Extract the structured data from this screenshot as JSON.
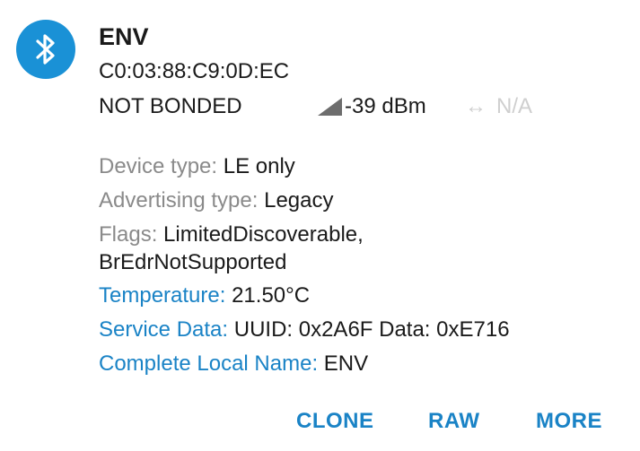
{
  "device": {
    "icon": "bluetooth-icon",
    "name": "ENV",
    "mac": "C0:03:88:C9:0D:EC",
    "bond_state": "NOT BONDED",
    "rssi": "-39 dBm",
    "interval_icon": "left-right-arrow-icon",
    "interval": "N/A"
  },
  "details": {
    "device_type": {
      "label": "Device type: ",
      "value": "LE only"
    },
    "advertising_type": {
      "label": "Advertising type: ",
      "value": "Legacy"
    },
    "flags": {
      "label": "Flags: ",
      "value": "LimitedDiscoverable, BrEdrNotSupported"
    },
    "temperature": {
      "label": "Temperature: ",
      "value": "21.50°C"
    },
    "service_data": {
      "label": "Service Data: ",
      "value": "UUID: 0x2A6F Data: 0xE716"
    },
    "local_name": {
      "label": "Complete Local Name: ",
      "value": "ENV"
    }
  },
  "actions": {
    "clone": "CLONE",
    "raw": "RAW",
    "more": "MORE"
  },
  "colors": {
    "accent": "#1A83C6",
    "avatar": "#1A91D6",
    "label_gray": "#8A8A8A",
    "disabled": "#CFCFCF"
  }
}
